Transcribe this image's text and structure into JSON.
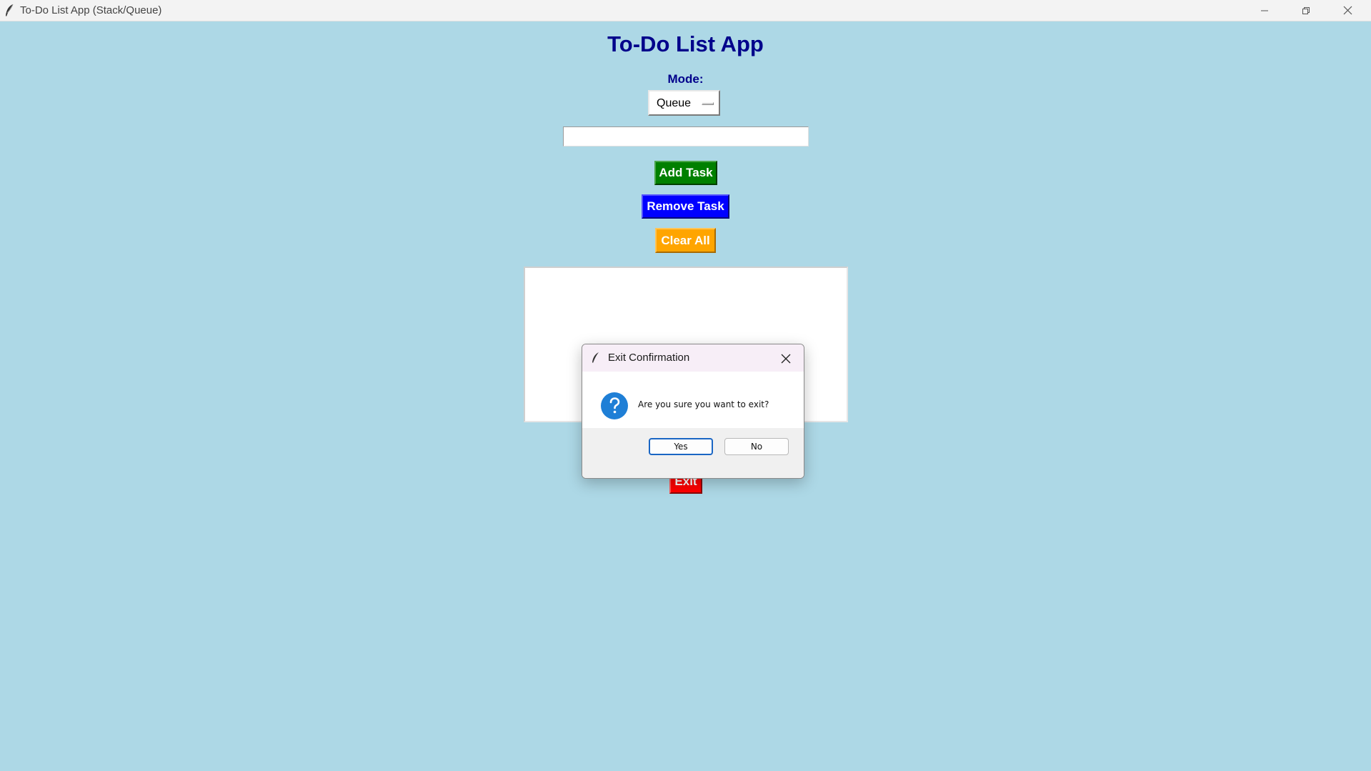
{
  "window": {
    "title": "To-Do List App (Stack/Queue)",
    "app_icon": "feather-icon",
    "controls": [
      "minimize-icon",
      "restore-icon",
      "close-icon"
    ]
  },
  "app": {
    "heading": "To-Do List App",
    "mode_label": "Mode:",
    "mode_value": "Queue",
    "task_input_value": "",
    "buttons": {
      "add": "Add Task",
      "remove": "Remove Task",
      "clear": "Clear All",
      "exit": "Exit"
    },
    "tasks": []
  },
  "dialog": {
    "title": "Exit Confirmation",
    "icon": "question-icon",
    "message": "Are you sure you want to exit?",
    "yes_label": "Yes",
    "no_label": "No"
  },
  "colors": {
    "background": "#add8e6",
    "heading": "#00008b",
    "add_button": "#008000",
    "remove_button": "#0000ff",
    "clear_button": "#ffa500",
    "exit_button": "#ff0000",
    "dialog_accent": "#1a66c4"
  }
}
